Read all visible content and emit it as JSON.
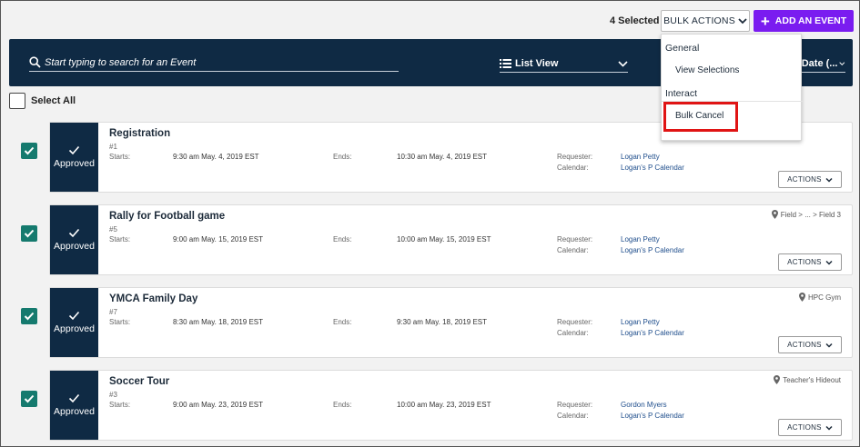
{
  "toolbar": {
    "selected_count": "4 Selected",
    "bulk_actions_label": "BULK ACTIONS",
    "add_event_label": "ADD AN EVENT"
  },
  "search": {
    "placeholder": "Start typing to search for an Event",
    "view_label": "List View",
    "sort_label": "t Date (..."
  },
  "select_all_label": "Select All",
  "bulk_menu": {
    "group_general": "General",
    "view_selections": "View Selections",
    "group_interact": "Interact",
    "bulk_cancel": "Bulk Cancel"
  },
  "labels": {
    "starts": "Starts:",
    "ends": "Ends:",
    "requester": "Requester:",
    "calendar": "Calendar:",
    "actions": "ACTIONS"
  },
  "events": [
    {
      "status": "Approved",
      "title": "Registration",
      "id": "#1",
      "starts": "9:30 am May. 4, 2019 EST",
      "ends": "10:30 am May. 4, 2019 EST",
      "requester": "Logan Petty",
      "calendar": "Logan's P Calendar",
      "location": ""
    },
    {
      "status": "Approved",
      "title": "Rally for Football game",
      "id": "#5",
      "starts": "9:00 am May. 15, 2019 EST",
      "ends": "10:00 am May. 15, 2019 EST",
      "requester": "Logan Petty",
      "calendar": "Logan's P Calendar",
      "location": "Field > ... > Field 3"
    },
    {
      "status": "Approved",
      "title": "YMCA Family Day",
      "id": "#7",
      "starts": "8:30 am May. 18, 2019 EST",
      "ends": "9:30 am May. 18, 2019 EST",
      "requester": "Logan Petty",
      "calendar": "Logan's P Calendar",
      "location": "HPC Gym"
    },
    {
      "status": "Approved",
      "title": "Soccer Tour",
      "id": "#3",
      "starts": "9:00 am May. 23, 2019 EST",
      "ends": "10:00 am May. 23, 2019 EST",
      "requester": "Gordon Myers",
      "calendar": "Logan's P Calendar",
      "location": "Teacher's Hideout"
    }
  ],
  "colors": {
    "navy": "#0f2a44",
    "accent_purple": "#7a1cf0",
    "checkbox_teal": "#157a6e",
    "highlight_red": "#e01414"
  }
}
